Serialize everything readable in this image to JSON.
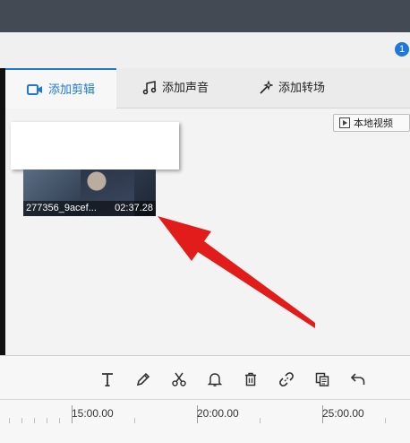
{
  "notification_count": "1",
  "tabs": [
    {
      "label": "添加剪辑",
      "icon": "video-camera-icon",
      "active": true
    },
    {
      "label": "添加声音",
      "icon": "music-note-icon",
      "active": false
    },
    {
      "label": "添加转场",
      "icon": "magic-wand-icon",
      "active": false
    }
  ],
  "local_video_button": "本地视频",
  "clip": {
    "filename": "277356_9acef...",
    "duration": "02:37.28"
  },
  "toolbar_tools": [
    "text-icon",
    "pencil-icon",
    "scissors-icon",
    "bell-icon",
    "trash-icon",
    "unlink-icon",
    "copy-icon",
    "undo-icon"
  ],
  "timeline": {
    "labels": [
      "15:00.00",
      "20:00.00",
      "25:00.00"
    ]
  },
  "colors": {
    "accent": "#1e78d7",
    "annotation_arrow": "#e21b1b",
    "top_bar": "#434a54"
  }
}
